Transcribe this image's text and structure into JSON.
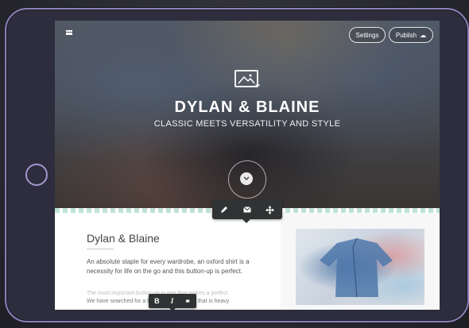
{
  "header": {
    "settings_label": "Settings",
    "publish_label": "Publish"
  },
  "hero": {
    "title": "DYLAN & BLAINE",
    "subtitle": "CLASSIC MEETS VERSATILITY AND STYLE"
  },
  "content": {
    "title": "Dylan & Blaine",
    "paragraph": "An absolute staple for every wardrobe, an oxford shirt is a necessity for life on the go and this button-up is perfect.",
    "faded_line_1": "The most important button-up is one that makes a perfect",
    "faded_line_2": "We have searched for a button-up in a fabric that is heavy"
  },
  "format_toolbar": {
    "bold_label": "B",
    "italic_label": "I"
  },
  "icons": {
    "menu": "hamburger-icon",
    "cloud": "cloud-upload-icon",
    "image": "image-placeholder-icon",
    "scroll": "chevron-down-icon",
    "edit": "pencil-icon",
    "mail": "mail-icon",
    "move": "move-icon",
    "link": "link-icon"
  },
  "colors": {
    "tablet_frame": "#2e2d3d",
    "tablet_border": "#8a82b8",
    "toolbar_bg": "#2f3333",
    "accent_strip": "#bfe2d8"
  }
}
